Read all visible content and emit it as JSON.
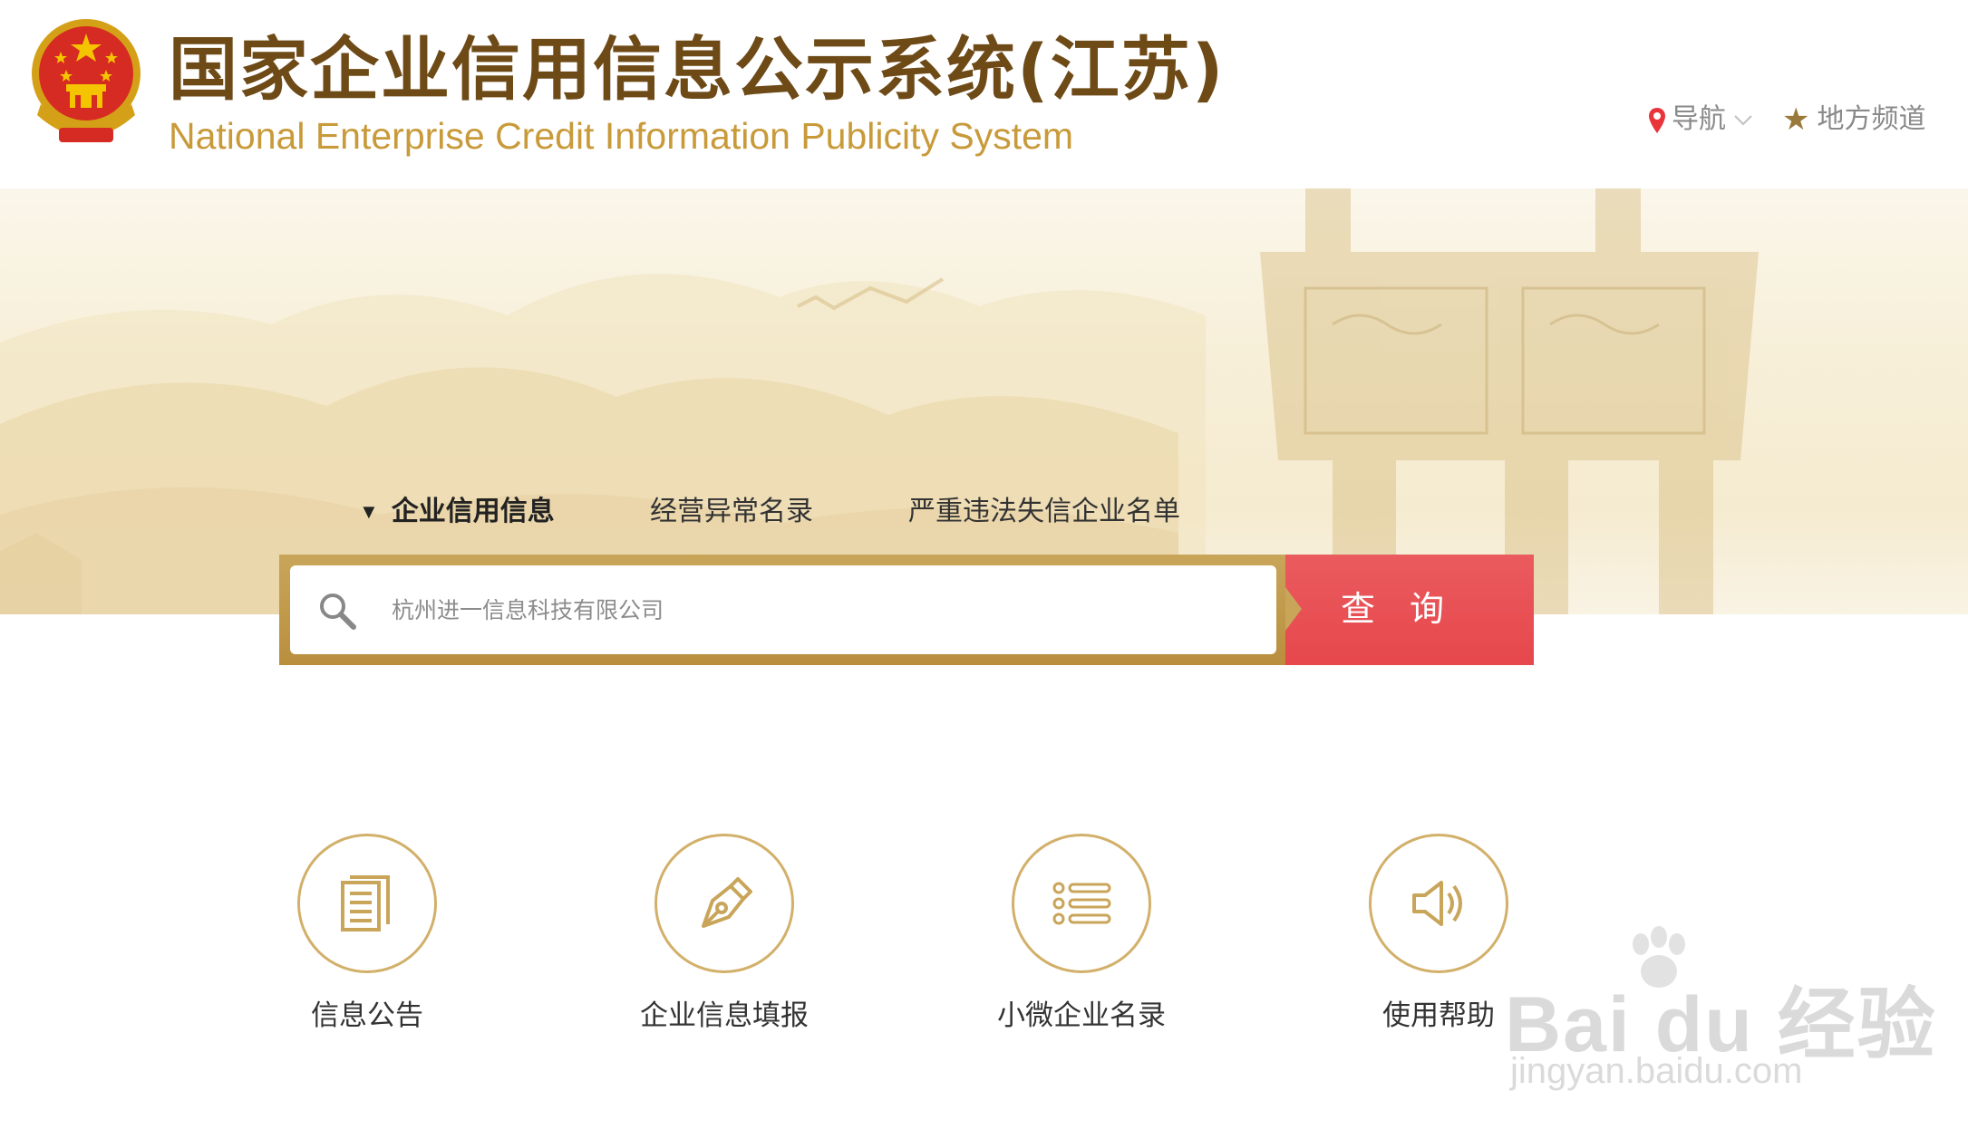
{
  "header": {
    "title_cn": "国家企业信用信息公示系统(江苏)",
    "title_en": "National Enterprise Credit Information Publicity System",
    "emblem_icon": "national-emblem-icon",
    "nav_guide_label": "导航",
    "nav_local_label": "地方频道"
  },
  "search": {
    "tabs": [
      {
        "label": "企业信用信息",
        "active": true
      },
      {
        "label": "经营异常名录",
        "active": false
      },
      {
        "label": "严重违法失信企业名单",
        "active": false
      }
    ],
    "placeholder": "杭州进一信息科技有限公司",
    "button_label": "查询"
  },
  "features": [
    {
      "label": "信息公告",
      "icon": "document-icon"
    },
    {
      "label": "企业信息填报",
      "icon": "pen-nib-icon"
    },
    {
      "label": "小微企业名录",
      "icon": "list-icon"
    },
    {
      "label": "使用帮助",
      "icon": "speaker-icon"
    }
  ],
  "watermark": {
    "brand": "Bai du 经验",
    "url": "jingyan.baidu.com"
  },
  "colors": {
    "gold": "#d2b06a",
    "title_brown": "#6e4a17",
    "search_red": "#e6474c",
    "english_gold": "#c89a3a"
  }
}
